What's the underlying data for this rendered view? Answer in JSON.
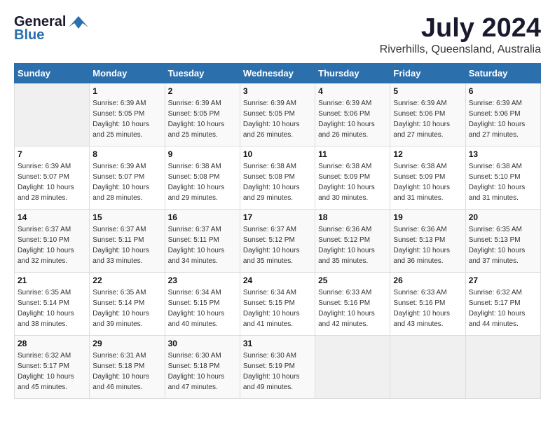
{
  "logo": {
    "general": "General",
    "blue": "Blue"
  },
  "title": "July 2024",
  "location": "Riverhills, Queensland, Australia",
  "days_header": [
    "Sunday",
    "Monday",
    "Tuesday",
    "Wednesday",
    "Thursday",
    "Friday",
    "Saturday"
  ],
  "weeks": [
    [
      {
        "day": "",
        "sunrise": "",
        "sunset": "",
        "daylight": ""
      },
      {
        "day": "1",
        "sunrise": "Sunrise: 6:39 AM",
        "sunset": "Sunset: 5:05 PM",
        "daylight": "Daylight: 10 hours and 25 minutes."
      },
      {
        "day": "2",
        "sunrise": "Sunrise: 6:39 AM",
        "sunset": "Sunset: 5:05 PM",
        "daylight": "Daylight: 10 hours and 25 minutes."
      },
      {
        "day": "3",
        "sunrise": "Sunrise: 6:39 AM",
        "sunset": "Sunset: 5:05 PM",
        "daylight": "Daylight: 10 hours and 26 minutes."
      },
      {
        "day": "4",
        "sunrise": "Sunrise: 6:39 AM",
        "sunset": "Sunset: 5:06 PM",
        "daylight": "Daylight: 10 hours and 26 minutes."
      },
      {
        "day": "5",
        "sunrise": "Sunrise: 6:39 AM",
        "sunset": "Sunset: 5:06 PM",
        "daylight": "Daylight: 10 hours and 27 minutes."
      },
      {
        "day": "6",
        "sunrise": "Sunrise: 6:39 AM",
        "sunset": "Sunset: 5:06 PM",
        "daylight": "Daylight: 10 hours and 27 minutes."
      }
    ],
    [
      {
        "day": "7",
        "sunrise": "Sunrise: 6:39 AM",
        "sunset": "Sunset: 5:07 PM",
        "daylight": "Daylight: 10 hours and 28 minutes."
      },
      {
        "day": "8",
        "sunrise": "Sunrise: 6:39 AM",
        "sunset": "Sunset: 5:07 PM",
        "daylight": "Daylight: 10 hours and 28 minutes."
      },
      {
        "day": "9",
        "sunrise": "Sunrise: 6:38 AM",
        "sunset": "Sunset: 5:08 PM",
        "daylight": "Daylight: 10 hours and 29 minutes."
      },
      {
        "day": "10",
        "sunrise": "Sunrise: 6:38 AM",
        "sunset": "Sunset: 5:08 PM",
        "daylight": "Daylight: 10 hours and 29 minutes."
      },
      {
        "day": "11",
        "sunrise": "Sunrise: 6:38 AM",
        "sunset": "Sunset: 5:09 PM",
        "daylight": "Daylight: 10 hours and 30 minutes."
      },
      {
        "day": "12",
        "sunrise": "Sunrise: 6:38 AM",
        "sunset": "Sunset: 5:09 PM",
        "daylight": "Daylight: 10 hours and 31 minutes."
      },
      {
        "day": "13",
        "sunrise": "Sunrise: 6:38 AM",
        "sunset": "Sunset: 5:10 PM",
        "daylight": "Daylight: 10 hours and 31 minutes."
      }
    ],
    [
      {
        "day": "14",
        "sunrise": "Sunrise: 6:37 AM",
        "sunset": "Sunset: 5:10 PM",
        "daylight": "Daylight: 10 hours and 32 minutes."
      },
      {
        "day": "15",
        "sunrise": "Sunrise: 6:37 AM",
        "sunset": "Sunset: 5:11 PM",
        "daylight": "Daylight: 10 hours and 33 minutes."
      },
      {
        "day": "16",
        "sunrise": "Sunrise: 6:37 AM",
        "sunset": "Sunset: 5:11 PM",
        "daylight": "Daylight: 10 hours and 34 minutes."
      },
      {
        "day": "17",
        "sunrise": "Sunrise: 6:37 AM",
        "sunset": "Sunset: 5:12 PM",
        "daylight": "Daylight: 10 hours and 35 minutes."
      },
      {
        "day": "18",
        "sunrise": "Sunrise: 6:36 AM",
        "sunset": "Sunset: 5:12 PM",
        "daylight": "Daylight: 10 hours and 35 minutes."
      },
      {
        "day": "19",
        "sunrise": "Sunrise: 6:36 AM",
        "sunset": "Sunset: 5:13 PM",
        "daylight": "Daylight: 10 hours and 36 minutes."
      },
      {
        "day": "20",
        "sunrise": "Sunrise: 6:35 AM",
        "sunset": "Sunset: 5:13 PM",
        "daylight": "Daylight: 10 hours and 37 minutes."
      }
    ],
    [
      {
        "day": "21",
        "sunrise": "Sunrise: 6:35 AM",
        "sunset": "Sunset: 5:14 PM",
        "daylight": "Daylight: 10 hours and 38 minutes."
      },
      {
        "day": "22",
        "sunrise": "Sunrise: 6:35 AM",
        "sunset": "Sunset: 5:14 PM",
        "daylight": "Daylight: 10 hours and 39 minutes."
      },
      {
        "day": "23",
        "sunrise": "Sunrise: 6:34 AM",
        "sunset": "Sunset: 5:15 PM",
        "daylight": "Daylight: 10 hours and 40 minutes."
      },
      {
        "day": "24",
        "sunrise": "Sunrise: 6:34 AM",
        "sunset": "Sunset: 5:15 PM",
        "daylight": "Daylight: 10 hours and 41 minutes."
      },
      {
        "day": "25",
        "sunrise": "Sunrise: 6:33 AM",
        "sunset": "Sunset: 5:16 PM",
        "daylight": "Daylight: 10 hours and 42 minutes."
      },
      {
        "day": "26",
        "sunrise": "Sunrise: 6:33 AM",
        "sunset": "Sunset: 5:16 PM",
        "daylight": "Daylight: 10 hours and 43 minutes."
      },
      {
        "day": "27",
        "sunrise": "Sunrise: 6:32 AM",
        "sunset": "Sunset: 5:17 PM",
        "daylight": "Daylight: 10 hours and 44 minutes."
      }
    ],
    [
      {
        "day": "28",
        "sunrise": "Sunrise: 6:32 AM",
        "sunset": "Sunset: 5:17 PM",
        "daylight": "Daylight: 10 hours and 45 minutes."
      },
      {
        "day": "29",
        "sunrise": "Sunrise: 6:31 AM",
        "sunset": "Sunset: 5:18 PM",
        "daylight": "Daylight: 10 hours and 46 minutes."
      },
      {
        "day": "30",
        "sunrise": "Sunrise: 6:30 AM",
        "sunset": "Sunset: 5:18 PM",
        "daylight": "Daylight: 10 hours and 47 minutes."
      },
      {
        "day": "31",
        "sunrise": "Sunrise: 6:30 AM",
        "sunset": "Sunset: 5:19 PM",
        "daylight": "Daylight: 10 hours and 49 minutes."
      },
      {
        "day": "",
        "sunrise": "",
        "sunset": "",
        "daylight": ""
      },
      {
        "day": "",
        "sunrise": "",
        "sunset": "",
        "daylight": ""
      },
      {
        "day": "",
        "sunrise": "",
        "sunset": "",
        "daylight": ""
      }
    ]
  ]
}
